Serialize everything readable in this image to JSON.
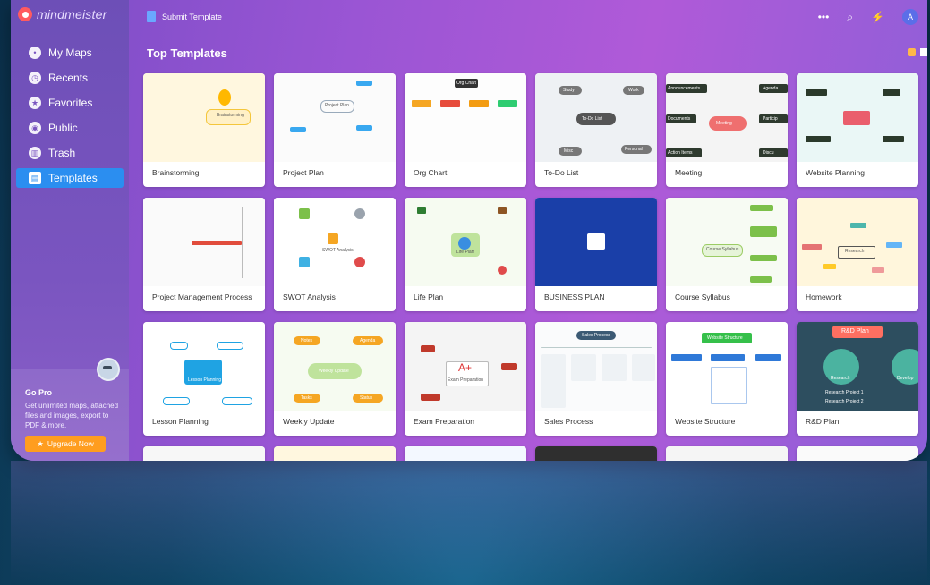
{
  "app": {
    "logo_text": "mindmeister",
    "submit_template": "Submit Template",
    "avatar_initial": "A"
  },
  "sidebar": {
    "items": [
      {
        "label": "My Maps",
        "icon": "maps-icon",
        "active": false
      },
      {
        "label": "Recents",
        "icon": "clock-icon",
        "active": false
      },
      {
        "label": "Favorites",
        "icon": "star-icon",
        "active": false
      },
      {
        "label": "Public",
        "icon": "globe-icon",
        "active": false
      },
      {
        "label": "Trash",
        "icon": "trash-icon",
        "active": false
      },
      {
        "label": "Templates",
        "icon": "template-icon",
        "active": true
      }
    ],
    "gopro": {
      "title": "Go Pro",
      "text": "Get unlimited maps, attached files and images, export to PDF & more.",
      "button": "Upgrade Now"
    }
  },
  "main": {
    "title": "Top Templates",
    "templates": [
      {
        "title": "Brainstorming"
      },
      {
        "title": "Project Plan"
      },
      {
        "title": "Org Chart"
      },
      {
        "title": "To-Do List"
      },
      {
        "title": "Meeting"
      },
      {
        "title": "Website Planning"
      },
      {
        "title": "Project Management Process"
      },
      {
        "title": "SWOT Analysis"
      },
      {
        "title": "Life Plan"
      },
      {
        "title": "BUSINESS PLAN"
      },
      {
        "title": "Course Syllabus"
      },
      {
        "title": "Homework"
      },
      {
        "title": "Lesson Planning"
      },
      {
        "title": "Weekly Update"
      },
      {
        "title": "Exam Preparation"
      },
      {
        "title": "Sales Process"
      },
      {
        "title": "Website Structure"
      },
      {
        "title": "R&D Plan"
      }
    ],
    "thumb_text": {
      "brainstorming_center": "Brainstorming",
      "todo_center": "To-Do List",
      "todo_study": "Study",
      "todo_work": "Work",
      "todo_misc": "Misc",
      "todo_personal": "Personal",
      "meeting_center": "Meeting",
      "meeting_announcements": "Announcements",
      "meeting_documents": "Documents",
      "meeting_action": "Action Items",
      "meeting_agenda": "Agenda",
      "meeting_participants": "Particip",
      "meeting_discuss": "Discu",
      "weekly_center": "Weekly Update",
      "weekly_notes": "Notes",
      "weekly_agenda": "Agenda",
      "weekly_tasks": "Tasks",
      "weekly_status": "Status",
      "exam_center": "Exam Preparation",
      "exam_grade": "A+",
      "web_structure_root": "Website Structure",
      "rd_root": "R&D Plan",
      "rd_research": "Research",
      "rd_project1": "Research Project 1",
      "rd_project2": "Research Project 2",
      "rd_develop": "Develop",
      "homework_center": "Research",
      "course_center": "Course Syllabus",
      "sales_root": "Sales Process",
      "project_plan_center": "Project Plan",
      "org_root": "Org Chart",
      "lesson_center": "Lesson Planning",
      "life_center": "Life Plan",
      "swot_center": "SWOT Analysis"
    }
  },
  "colors": {
    "accent": "#2b8ef0",
    "upgrade": "#ff9d1f",
    "logo": "#ff5a5f"
  }
}
